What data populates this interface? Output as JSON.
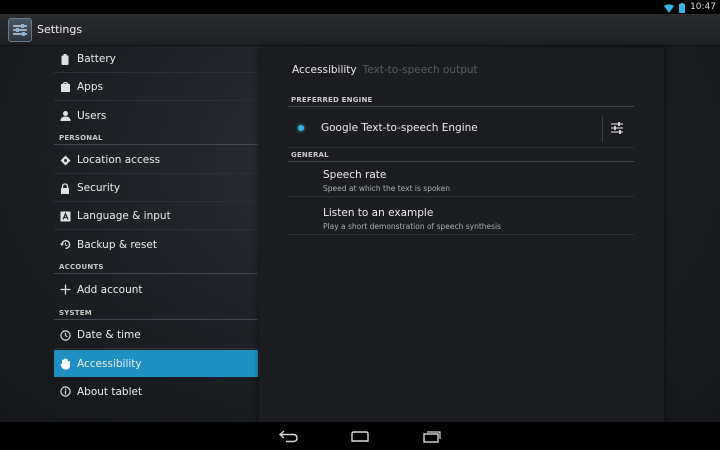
{
  "status": {
    "time": "10:47"
  },
  "actionbar": {
    "title": "Settings"
  },
  "sidebar": {
    "items_top": [
      {
        "label": "Battery",
        "icon": "battery-icon"
      },
      {
        "label": "Apps",
        "icon": "apps-icon"
      },
      {
        "label": "Users",
        "icon": "users-icon"
      }
    ],
    "personal_header": "PERSONAL",
    "items_personal": [
      {
        "label": "Location access",
        "icon": "location-icon"
      },
      {
        "label": "Security",
        "icon": "lock-icon"
      },
      {
        "label": "Language & input",
        "icon": "language-icon"
      },
      {
        "label": "Backup & reset",
        "icon": "backup-icon"
      }
    ],
    "accounts_header": "ACCOUNTS",
    "items_accounts": [
      {
        "label": "Add account",
        "icon": "plus-icon"
      }
    ],
    "system_header": "SYSTEM",
    "items_system": [
      {
        "label": "Date & time",
        "icon": "clock-icon"
      },
      {
        "label": "Accessibility",
        "icon": "hand-icon",
        "selected": true
      },
      {
        "label": "About tablet",
        "icon": "info-icon"
      }
    ]
  },
  "panel": {
    "breadcrumb_current": "Accessibility",
    "breadcrumb_sub": "Text-to-speech output",
    "preferred_engine_header": "PREFERRED ENGINE",
    "engine_label": "Google Text-to-speech Engine",
    "general_header": "GENERAL",
    "speech_rate_title": "Speech rate",
    "speech_rate_summary": "Speed at which the text is spoken",
    "example_title": "Listen to an example",
    "example_summary": "Play a short demonstration of speech synthesis"
  },
  "colors": {
    "accent": "#1f8fc2",
    "radio": "#33b5e5"
  }
}
